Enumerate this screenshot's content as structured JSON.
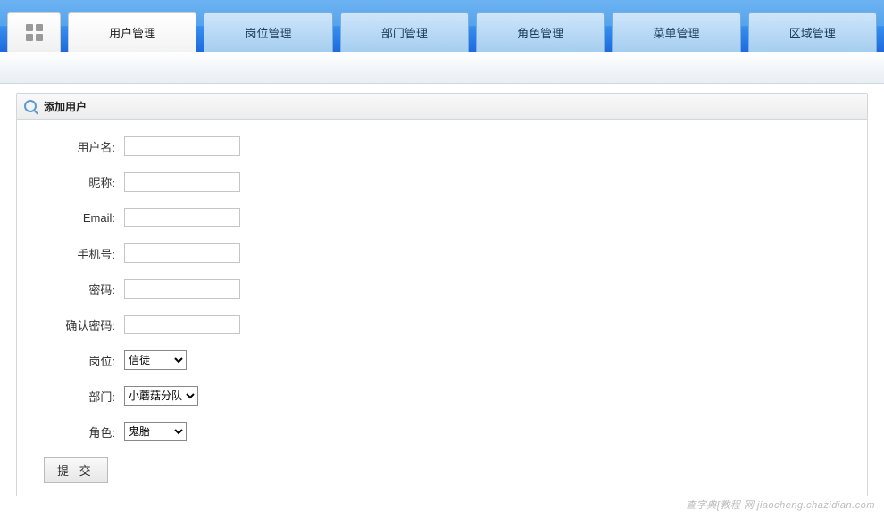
{
  "tabs": [
    {
      "label": "用户管理"
    },
    {
      "label": "岗位管理"
    },
    {
      "label": "部门管理"
    },
    {
      "label": "角色管理"
    },
    {
      "label": "菜单管理"
    },
    {
      "label": "区域管理"
    }
  ],
  "panel": {
    "title": "添加用户"
  },
  "form": {
    "username_label": "用户名:",
    "nickname_label": "昵称:",
    "email_label": "Email:",
    "phone_label": "手机号:",
    "password_label": "密码:",
    "confirm_label": "确认密码:",
    "position_label": "岗位:",
    "position_value": "信徒",
    "department_label": "部门:",
    "department_value": "小蘑菇分队",
    "role_label": "角色:",
    "role_value": "鬼胎",
    "submit_label": "提 交"
  },
  "watermark": "查字典[教程 网 jiaocheng.chazidian.com"
}
